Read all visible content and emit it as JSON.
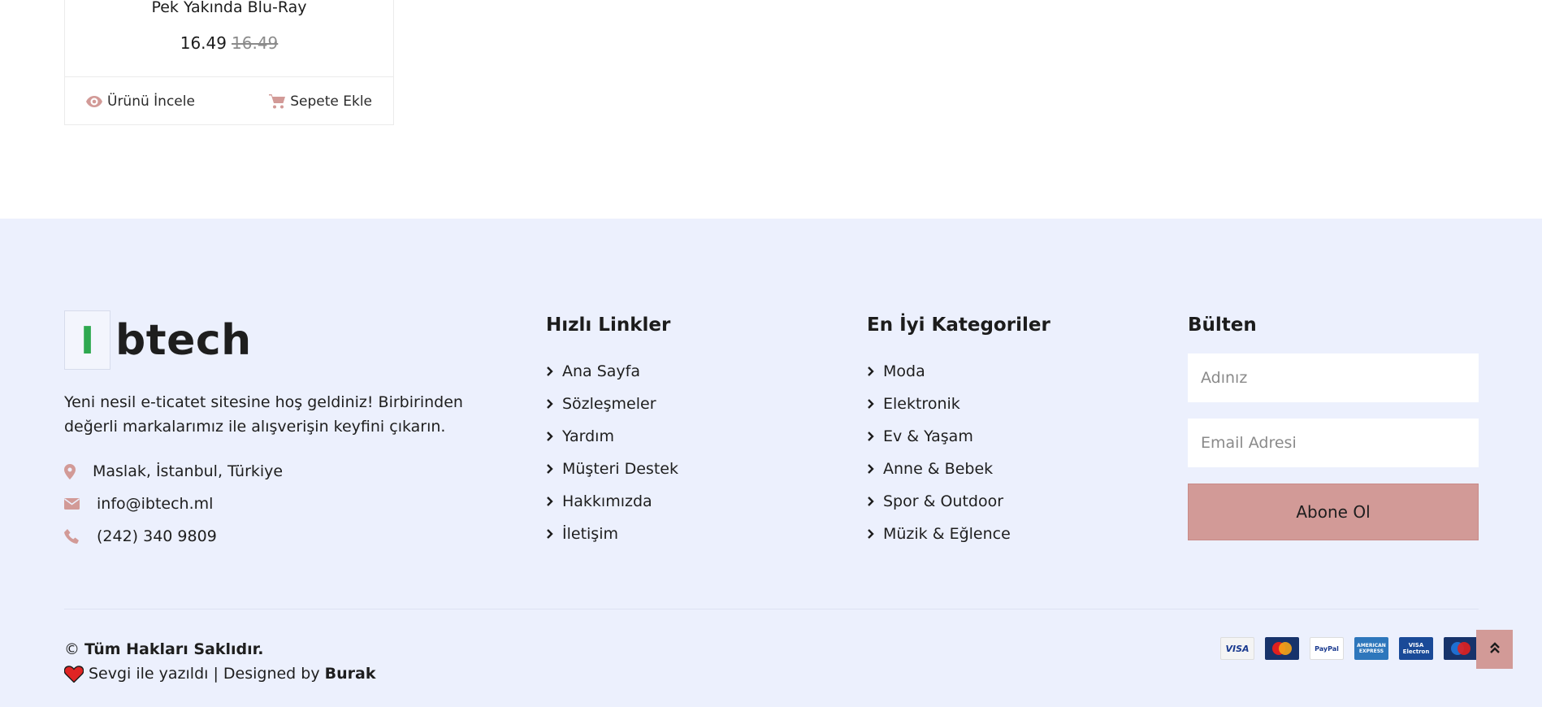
{
  "product_card": {
    "title": "Pek Yakında Blu-Ray",
    "price_current": "16.49",
    "price_old": "16.49",
    "view_label": "Ürünü İncele",
    "cart_label": "Sepete Ekle"
  },
  "footer": {
    "logo": {
      "letter": "I",
      "text": "btech"
    },
    "about": "Yeni nesil e-ticatet sitesine hoş geldiniz! Birbirinden değerli markalarımız ile alışverişin keyfini çıkarın.",
    "contact": {
      "address": "Maslak, İstanbul, Türkiye",
      "email": "info@ibtech.ml",
      "phone": "(242) 340 9809"
    },
    "quick_links": {
      "title": "Hızlı Linkler",
      "items": [
        "Ana Sayfa",
        "Sözleşmeler",
        "Yardım",
        "Müşteri Destek",
        "Hakkımızda",
        "İletişim"
      ]
    },
    "categories": {
      "title": "En İyi Kategoriler",
      "items": [
        "Moda",
        "Elektronik",
        "Ev & Yaşam",
        "Anne & Bebek",
        "Spor & Outdoor",
        "Müzik & Eğlence"
      ]
    },
    "newsletter": {
      "title": "Bülten",
      "name_placeholder": "Adınız",
      "email_placeholder": "Email Adresi",
      "button": "Abone Ol"
    },
    "copyright": {
      "symbol": "©",
      "rights": "Tüm Hakları Saklıdır.",
      "made_with": "Sevgi ile yazıldı | Designed by",
      "author": "Burak"
    },
    "payments": [
      "VISA",
      "MasterCard",
      "PayPal",
      "AMERICAN EXPRESS",
      "VISA Electron",
      "Maestro"
    ]
  },
  "colors": {
    "accent": "#d29a97",
    "footer_bg": "#ecf0fd",
    "logo_green": "#2ea84f"
  },
  "icons": {
    "view": "eye-icon",
    "cart": "cart-icon",
    "location": "map-pin-icon",
    "email": "envelope-icon",
    "phone": "phone-icon",
    "link_marker": "chevron-right-icon",
    "love": "heart-icon",
    "scroll_top": "double-chevron-up-icon"
  }
}
